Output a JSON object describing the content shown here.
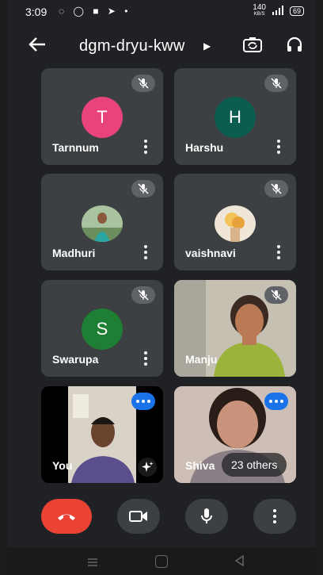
{
  "status_bar": {
    "time": "3:09",
    "left_icons": "◌ ◯ ■ ➤ •",
    "speed_value": "140",
    "speed_unit": "KB/S",
    "battery": "69"
  },
  "header": {
    "meeting_code": "dgm-dryu-kww"
  },
  "participants": [
    {
      "name": "Tarnnum",
      "initial": "T",
      "color": "#e8437a"
    },
    {
      "name": "Harshu",
      "initial": "H",
      "color": "#0b5d4f"
    },
    {
      "name": "Madhuri"
    },
    {
      "name": "vaishnavi"
    },
    {
      "name": "Swarupa",
      "initial": "S",
      "color": "#1e7e34"
    },
    {
      "name": "Manju"
    },
    {
      "name": "You"
    },
    {
      "name": "Shiva"
    }
  ],
  "others_label": "23 others",
  "colors": {
    "background": "#202124",
    "tile": "#3c4043",
    "end_call": "#ea4335",
    "speaking": "#1a73e8"
  }
}
